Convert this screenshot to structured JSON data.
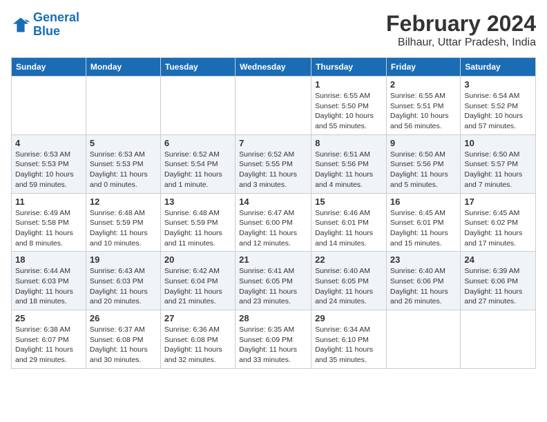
{
  "header": {
    "logo_line1": "General",
    "logo_line2": "Blue",
    "main_title": "February 2024",
    "subtitle": "Bilhaur, Uttar Pradesh, India"
  },
  "days_of_week": [
    "Sunday",
    "Monday",
    "Tuesday",
    "Wednesday",
    "Thursday",
    "Friday",
    "Saturday"
  ],
  "weeks": [
    [
      {
        "day": "",
        "info": ""
      },
      {
        "day": "",
        "info": ""
      },
      {
        "day": "",
        "info": ""
      },
      {
        "day": "",
        "info": ""
      },
      {
        "day": "1",
        "info": "Sunrise: 6:55 AM\nSunset: 5:50 PM\nDaylight: 10 hours\nand 55 minutes."
      },
      {
        "day": "2",
        "info": "Sunrise: 6:55 AM\nSunset: 5:51 PM\nDaylight: 10 hours\nand 56 minutes."
      },
      {
        "day": "3",
        "info": "Sunrise: 6:54 AM\nSunset: 5:52 PM\nDaylight: 10 hours\nand 57 minutes."
      }
    ],
    [
      {
        "day": "4",
        "info": "Sunrise: 6:53 AM\nSunset: 5:53 PM\nDaylight: 10 hours\nand 59 minutes."
      },
      {
        "day": "5",
        "info": "Sunrise: 6:53 AM\nSunset: 5:53 PM\nDaylight: 11 hours\nand 0 minutes."
      },
      {
        "day": "6",
        "info": "Sunrise: 6:52 AM\nSunset: 5:54 PM\nDaylight: 11 hours\nand 1 minute."
      },
      {
        "day": "7",
        "info": "Sunrise: 6:52 AM\nSunset: 5:55 PM\nDaylight: 11 hours\nand 3 minutes."
      },
      {
        "day": "8",
        "info": "Sunrise: 6:51 AM\nSunset: 5:56 PM\nDaylight: 11 hours\nand 4 minutes."
      },
      {
        "day": "9",
        "info": "Sunrise: 6:50 AM\nSunset: 5:56 PM\nDaylight: 11 hours\nand 5 minutes."
      },
      {
        "day": "10",
        "info": "Sunrise: 6:50 AM\nSunset: 5:57 PM\nDaylight: 11 hours\nand 7 minutes."
      }
    ],
    [
      {
        "day": "11",
        "info": "Sunrise: 6:49 AM\nSunset: 5:58 PM\nDaylight: 11 hours\nand 8 minutes."
      },
      {
        "day": "12",
        "info": "Sunrise: 6:48 AM\nSunset: 5:59 PM\nDaylight: 11 hours\nand 10 minutes."
      },
      {
        "day": "13",
        "info": "Sunrise: 6:48 AM\nSunset: 5:59 PM\nDaylight: 11 hours\nand 11 minutes."
      },
      {
        "day": "14",
        "info": "Sunrise: 6:47 AM\nSunset: 6:00 PM\nDaylight: 11 hours\nand 12 minutes."
      },
      {
        "day": "15",
        "info": "Sunrise: 6:46 AM\nSunset: 6:01 PM\nDaylight: 11 hours\nand 14 minutes."
      },
      {
        "day": "16",
        "info": "Sunrise: 6:45 AM\nSunset: 6:01 PM\nDaylight: 11 hours\nand 15 minutes."
      },
      {
        "day": "17",
        "info": "Sunrise: 6:45 AM\nSunset: 6:02 PM\nDaylight: 11 hours\nand 17 minutes."
      }
    ],
    [
      {
        "day": "18",
        "info": "Sunrise: 6:44 AM\nSunset: 6:03 PM\nDaylight: 11 hours\nand 18 minutes."
      },
      {
        "day": "19",
        "info": "Sunrise: 6:43 AM\nSunset: 6:03 PM\nDaylight: 11 hours\nand 20 minutes."
      },
      {
        "day": "20",
        "info": "Sunrise: 6:42 AM\nSunset: 6:04 PM\nDaylight: 11 hours\nand 21 minutes."
      },
      {
        "day": "21",
        "info": "Sunrise: 6:41 AM\nSunset: 6:05 PM\nDaylight: 11 hours\nand 23 minutes."
      },
      {
        "day": "22",
        "info": "Sunrise: 6:40 AM\nSunset: 6:05 PM\nDaylight: 11 hours\nand 24 minutes."
      },
      {
        "day": "23",
        "info": "Sunrise: 6:40 AM\nSunset: 6:06 PM\nDaylight: 11 hours\nand 26 minutes."
      },
      {
        "day": "24",
        "info": "Sunrise: 6:39 AM\nSunset: 6:06 PM\nDaylight: 11 hours\nand 27 minutes."
      }
    ],
    [
      {
        "day": "25",
        "info": "Sunrise: 6:38 AM\nSunset: 6:07 PM\nDaylight: 11 hours\nand 29 minutes."
      },
      {
        "day": "26",
        "info": "Sunrise: 6:37 AM\nSunset: 6:08 PM\nDaylight: 11 hours\nand 30 minutes."
      },
      {
        "day": "27",
        "info": "Sunrise: 6:36 AM\nSunset: 6:08 PM\nDaylight: 11 hours\nand 32 minutes."
      },
      {
        "day": "28",
        "info": "Sunrise: 6:35 AM\nSunset: 6:09 PM\nDaylight: 11 hours\nand 33 minutes."
      },
      {
        "day": "29",
        "info": "Sunrise: 6:34 AM\nSunset: 6:10 PM\nDaylight: 11 hours\nand 35 minutes."
      },
      {
        "day": "",
        "info": ""
      },
      {
        "day": "",
        "info": ""
      }
    ]
  ]
}
